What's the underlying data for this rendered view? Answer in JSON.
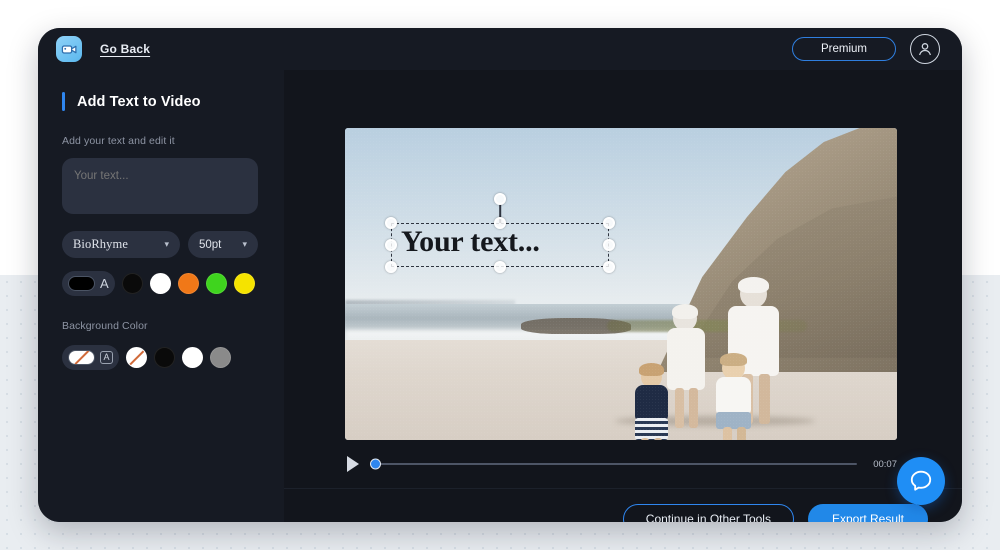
{
  "header": {
    "logo_icon": "video-camera-icon",
    "go_back_label": "Go Back",
    "premium_label": "Premium",
    "avatar_icon": "user-avatar-icon"
  },
  "sidebar": {
    "panel_title": "Add Text to Video",
    "text_section_label": "Add your text and edit it",
    "text_input_value": "",
    "text_input_placeholder": "Your text...",
    "font_dropdown": {
      "value": "BioRhyme",
      "chevron": "⌄"
    },
    "size_dropdown": {
      "value": "50pt",
      "chevron": "⌄"
    },
    "text_color": {
      "selected_hex": "#000000",
      "glyph": "A",
      "swatches": [
        {
          "name": "black",
          "hex": "#0a0a0a"
        },
        {
          "name": "white",
          "hex": "#ffffff"
        },
        {
          "name": "orange",
          "hex": "#f07818"
        },
        {
          "name": "green",
          "hex": "#3fd41e"
        },
        {
          "name": "yellow",
          "hex": "#f5e300"
        }
      ]
    },
    "background_color": {
      "section_label": "Background Color",
      "selected_name": "none",
      "glyph": "A",
      "swatches": [
        {
          "name": "none",
          "hex": "#ffffff"
        },
        {
          "name": "black",
          "hex": "#0a0a0a"
        },
        {
          "name": "white",
          "hex": "#ffffff"
        },
        {
          "name": "gray",
          "hex": "#8a8a8a"
        }
      ]
    }
  },
  "editor": {
    "overlay_text": "Your text...",
    "player": {
      "play_icon": "play-icon",
      "progress_percent": 0,
      "time_label": "00:07"
    }
  },
  "footer": {
    "continue_label": "Continue in Other Tools",
    "export_label": "Export Result",
    "support_icon": "chat-bubble-icon"
  },
  "colors": {
    "accent_blue": "#2f86ef",
    "export_blue": "#2188e8",
    "window_bg": "#12151c",
    "panel_bg": "#161a23",
    "field_bg": "#2b3140"
  }
}
